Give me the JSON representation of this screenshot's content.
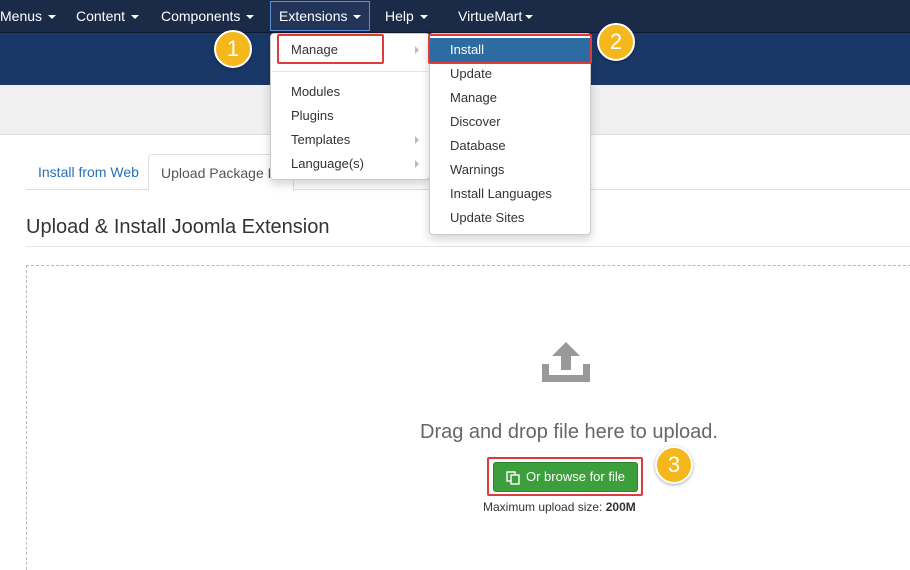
{
  "topnav": {
    "items": [
      {
        "label": "Menus"
      },
      {
        "label": "Content"
      },
      {
        "label": "Components"
      },
      {
        "label": "Extensions"
      },
      {
        "label": "Help"
      },
      {
        "label": "VirtueMart"
      }
    ]
  },
  "extensions_menu": {
    "items": [
      {
        "label": "Manage"
      },
      {
        "label": "Modules"
      },
      {
        "label": "Plugins"
      },
      {
        "label": "Templates"
      },
      {
        "label": "Language(s)"
      }
    ]
  },
  "manage_submenu": {
    "items": [
      {
        "label": "Install"
      },
      {
        "label": "Update"
      },
      {
        "label": "Manage"
      },
      {
        "label": "Discover"
      },
      {
        "label": "Database"
      },
      {
        "label": "Warnings"
      },
      {
        "label": "Install Languages"
      },
      {
        "label": "Update Sites"
      }
    ]
  },
  "tabs": [
    {
      "label": "Install from Web"
    },
    {
      "label": "Upload Package Fi"
    }
  ],
  "main": {
    "title": "Upload & Install Joomla Extension",
    "drag_text": "Drag and drop file here to upload.",
    "browse_label": "Or browse for file",
    "max_label": "Maximum upload size:",
    "max_value": "200M"
  },
  "annotations": {
    "step1": "1",
    "step2": "2",
    "step3": "3"
  },
  "colors": {
    "nav_bg": "#1b2a47",
    "header_bg": "#1a3867",
    "menu_highlight": "#2d6ca2",
    "browse_button": "#3c9f3c",
    "step_badge": "#f5b81c",
    "annotation_box": "#e03b3b"
  },
  "icons": {
    "upload": "upload-icon",
    "browse": "file-copy-icon",
    "caret": "caret-down-icon",
    "submenu": "chevron-right-icon"
  }
}
